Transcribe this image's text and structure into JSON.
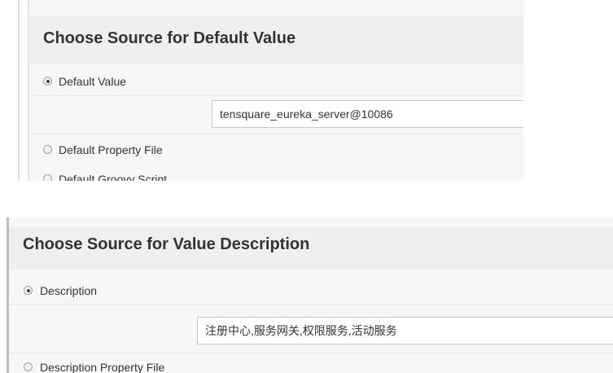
{
  "default_value_section": {
    "title": "Choose Source for Default Value",
    "options": [
      {
        "label": "Default Value",
        "checked": true
      },
      {
        "label": "Default Property File",
        "checked": false
      },
      {
        "label": "Default Groovy Script",
        "checked": false
      }
    ],
    "value_input": {
      "value": "tensquare_eureka_server@10086"
    }
  },
  "value_description_section": {
    "title": "Choose Source for Value Description",
    "options": [
      {
        "label": "Description",
        "checked": true
      },
      {
        "label": "Description Property File",
        "checked": false
      }
    ],
    "description_input": {
      "value": "注册中心,服务网关,权限服务,活动服务"
    }
  }
}
